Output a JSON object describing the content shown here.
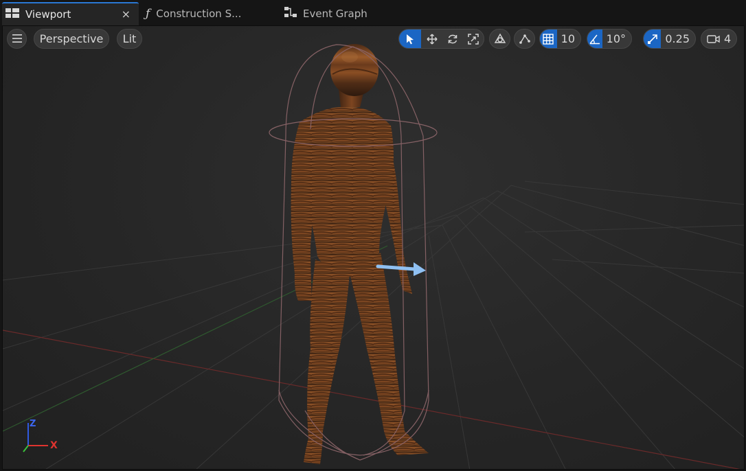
{
  "tabs": [
    {
      "label": "Viewport",
      "icon": "viewport-grid-icon",
      "active": true,
      "close": "×"
    },
    {
      "label": "Construction S...",
      "icon": "function-icon"
    },
    {
      "label": "Event Graph",
      "icon": "event-graph-icon"
    }
  ],
  "toolbar": {
    "menu_icon": "hamburger-icon",
    "view_mode": "Perspective",
    "lighting": "Lit",
    "grid_snap": "10",
    "rotation_snap": "10°",
    "scale_snap": "0.25",
    "camera_speed": "4"
  },
  "axes": {
    "z": "Z",
    "x": "X"
  },
  "colors": {
    "accent": "#1b66c4",
    "tab_highlight": "#2a78d4",
    "capsule": "#8a6468",
    "arrow": "#8fc0f2",
    "axis_x": "#e0342f",
    "axis_y": "#3bc23b",
    "axis_z": "#2f5ae0"
  }
}
